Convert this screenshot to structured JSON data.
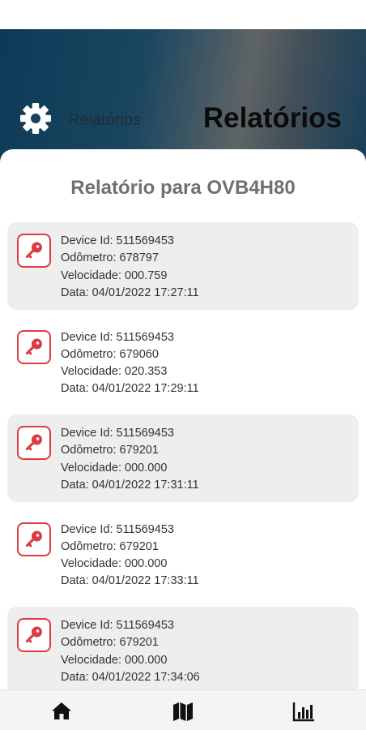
{
  "header": {
    "settings_label": "Relatórios",
    "title": "Relatórios"
  },
  "report": {
    "title": "Relatório para OVB4H80",
    "entries": [
      {
        "device": "Device Id: 511569453",
        "odometer": "Odômetro: 678797",
        "speed": "Velocidade: 000.759",
        "date": "Data: 04/01/2022 17:27:11"
      },
      {
        "device": "Device Id: 511569453",
        "odometer": "Odômetro: 679060",
        "speed": "Velocidade: 020.353",
        "date": "Data: 04/01/2022 17:29:11"
      },
      {
        "device": "Device Id: 511569453",
        "odometer": "Odômetro: 679201",
        "speed": "Velocidade: 000.000",
        "date": "Data: 04/01/2022 17:31:11"
      },
      {
        "device": "Device Id: 511569453",
        "odometer": "Odômetro: 679201",
        "speed": "Velocidade: 000.000",
        "date": "Data: 04/01/2022 17:33:11"
      },
      {
        "device": "Device Id: 511569453",
        "odometer": "Odômetro: 679201",
        "speed": "Velocidade: 000.000",
        "date": "Data: 04/01/2022 17:34:06"
      }
    ]
  },
  "icons": {
    "settings": "gear-icon",
    "entry": "key-icon",
    "nav_home": "home-icon",
    "nav_map": "map-icon",
    "nav_reports": "bar-chart-icon"
  },
  "colors": {
    "accent": "#de3b44",
    "card_shaded": "#eeeeee"
  }
}
